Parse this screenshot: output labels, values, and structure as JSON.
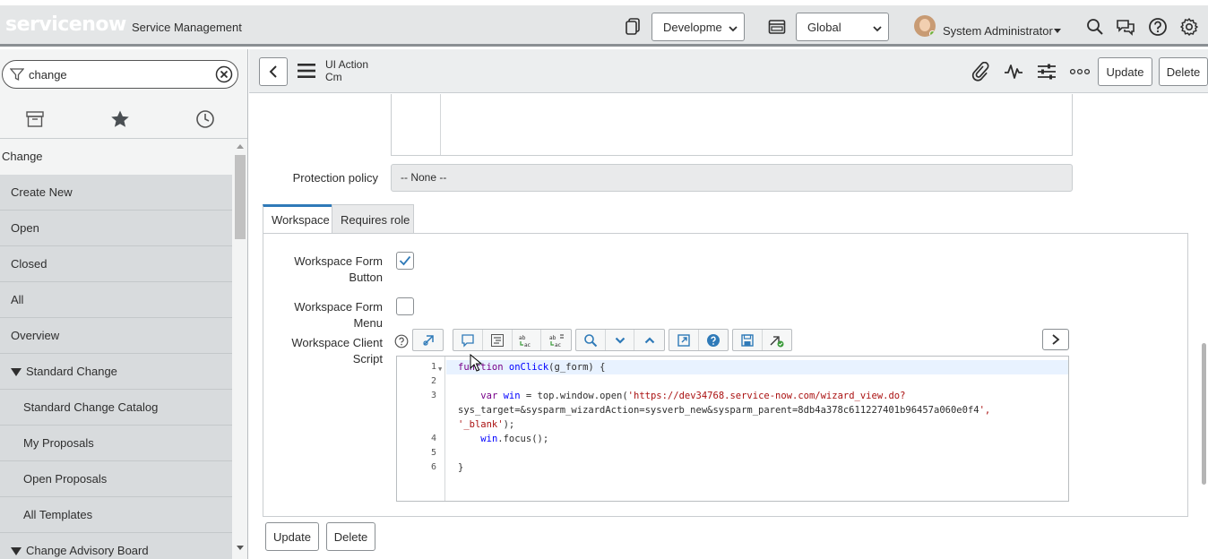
{
  "banner": {
    "logo_text": "servicenow",
    "product_name": "Service Management",
    "update_set": "Developme",
    "scope": "Global",
    "user_name": "System Administrator"
  },
  "navigator": {
    "filter_value": "change",
    "items": [
      {
        "label": "Change",
        "kind": "app"
      },
      {
        "label": "Create New",
        "kind": "module"
      },
      {
        "label": "Open",
        "kind": "module"
      },
      {
        "label": "Closed",
        "kind": "module"
      },
      {
        "label": "All",
        "kind": "module"
      },
      {
        "label": "Overview",
        "kind": "module"
      },
      {
        "label": "Standard Change",
        "kind": "section"
      },
      {
        "label": "Standard Change Catalog",
        "kind": "module2"
      },
      {
        "label": "My Proposals",
        "kind": "module2"
      },
      {
        "label": "Open Proposals",
        "kind": "module2"
      },
      {
        "label": "All Templates",
        "kind": "module2"
      },
      {
        "label": "Change Advisory Board",
        "kind": "section"
      }
    ]
  },
  "form_header": {
    "record_type": "UI Action",
    "record_name": "Cm",
    "update_label": "Update",
    "delete_label": "Delete"
  },
  "form": {
    "protection_policy_label": "Protection policy",
    "protection_policy_value": "-- None --",
    "tabs": [
      {
        "label": "Workspace",
        "active": true
      },
      {
        "label": "Requires role",
        "active": false
      }
    ],
    "workspace_form_button_label_1": "Workspace Form",
    "workspace_form_button_label_2": "Button",
    "workspace_form_button_checked": true,
    "workspace_form_menu_label": "Workspace Form Menu",
    "workspace_form_menu_checked": false,
    "workspace_client_script_label_1": "Workspace Client",
    "workspace_client_script_label_2": "Script",
    "code_lines": [
      {
        "num": "1",
        "text": "function onClick(g_form) {"
      },
      {
        "num": "2",
        "text": ""
      },
      {
        "num": "3",
        "text": "    var win = top.window.open('https://dev34768.service-now.com/wizard_view.do?"
      },
      {
        "num": "",
        "text": "sys_target=&sysparm_wizardAction=sysverb_new&sysparm_parent=8db4a378c611227401b96457a060e0f4',"
      },
      {
        "num": "",
        "text": "'_blank');"
      },
      {
        "num": "4",
        "text": "    win.focus();"
      },
      {
        "num": "5",
        "text": ""
      },
      {
        "num": "6",
        "text": "}"
      }
    ],
    "bottom_update_label": "Update",
    "bottom_delete_label": "Delete"
  },
  "colors": {
    "banner_bg": "#e4e6e7",
    "active_tab_accent": "#2f7ab8",
    "nav_module_bg": "#d8dbdd",
    "checkbox_check": "#2f7ab8"
  }
}
